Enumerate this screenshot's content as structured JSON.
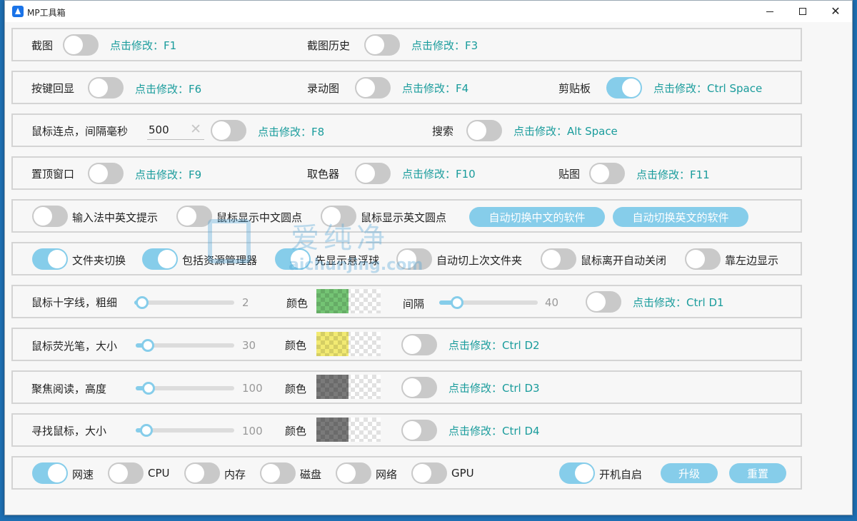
{
  "window": {
    "title": "MP工具箱"
  },
  "rows": [
    {
      "items": [
        {
          "label": "截图",
          "toggle_on": false,
          "hotkey": "点击修改：F1"
        },
        {
          "label": "截图历史",
          "toggle_on": false,
          "hotkey": "点击修改：F3"
        }
      ]
    },
    {
      "items": [
        {
          "label": "按键回显",
          "toggle_on": false,
          "hotkey": "点击修改：F6"
        },
        {
          "label": "录动图",
          "toggle_on": false,
          "hotkey": "点击修改：F4"
        },
        {
          "label": "剪贴板",
          "toggle_on": true,
          "hotkey": "点击修改：Ctrl Space"
        }
      ]
    },
    {
      "click_label": "鼠标连点，间隔毫秒",
      "interval_value": "500",
      "clear_glyph": "✕",
      "items": [
        {
          "toggle_on": false,
          "hotkey": "点击修改：F8"
        },
        {
          "label": "搜索",
          "toggle_on": false,
          "hotkey": "点击修改：Alt Space"
        }
      ]
    },
    {
      "items": [
        {
          "label": "置顶窗口",
          "toggle_on": false,
          "hotkey": "点击修改：F9"
        },
        {
          "label": "取色器",
          "toggle_on": false,
          "hotkey": "点击修改：F10"
        },
        {
          "label": "贴图",
          "toggle_on": false,
          "hotkey": "点击修改：F11"
        }
      ]
    },
    {
      "items": [
        {
          "label": "输入法中英文提示",
          "toggle_on": false
        },
        {
          "label": "鼠标显示中文圆点",
          "toggle_on": false
        },
        {
          "label": "鼠标显示英文圆点",
          "toggle_on": false
        }
      ],
      "buttons": [
        "自动切换中文的软件",
        "自动切换英文的软件"
      ]
    },
    {
      "items": [
        {
          "label": "文件夹切换",
          "toggle_on": true
        },
        {
          "label": "包括资源管理器",
          "toggle_on": true
        },
        {
          "label": "先显示悬浮球",
          "toggle_on": true
        },
        {
          "label": "自动切上次文件夹",
          "toggle_on": false
        },
        {
          "label": "鼠标离开自动关闭",
          "toggle_on": false
        },
        {
          "label": "靠左边显示",
          "toggle_on": false
        }
      ]
    }
  ],
  "crosshair": {
    "label": "鼠标十字线，粗细",
    "thickness": 2,
    "color_label": "颜色",
    "color": "#74c474",
    "gap_label": "间隔",
    "gap": 40,
    "toggle_on": false,
    "hotkey": "点击修改：Ctrl D1"
  },
  "highlighter": {
    "label": "鼠标荧光笔，大小",
    "size": 30,
    "color_label": "颜色",
    "color": "#f2ea72",
    "toggle_on": false,
    "hotkey": "点击修改：Ctrl D2"
  },
  "focus": {
    "label": "聚焦阅读，高度",
    "height": 100,
    "color_label": "颜色",
    "color": "#7a7a7a",
    "toggle_on": false,
    "hotkey": "点击修改：Ctrl D3"
  },
  "finder": {
    "label": "寻找鼠标，大小",
    "size": 100,
    "color_label": "颜色",
    "color": "#7a7a7a",
    "toggle_on": false,
    "hotkey": "点击修改：Ctrl D4"
  },
  "status": {
    "items": [
      {
        "label": "网速",
        "toggle_on": true
      },
      {
        "label": "CPU",
        "toggle_on": false
      },
      {
        "label": "内存",
        "toggle_on": false
      },
      {
        "label": "磁盘",
        "toggle_on": false
      },
      {
        "label": "网络",
        "toggle_on": false
      },
      {
        "label": "GPU",
        "toggle_on": false
      }
    ],
    "autostart": {
      "label": "开机自启",
      "toggle_on": true
    },
    "upgrade_label": "升级",
    "reset_label": "重置"
  },
  "watermark": {
    "cn": "爱纯净",
    "en": "aichunjing.com"
  },
  "colors": {
    "accent": "#86cdea",
    "hotkey_text": "#1a9c9c",
    "toggle_off": "#c9c9c9"
  }
}
